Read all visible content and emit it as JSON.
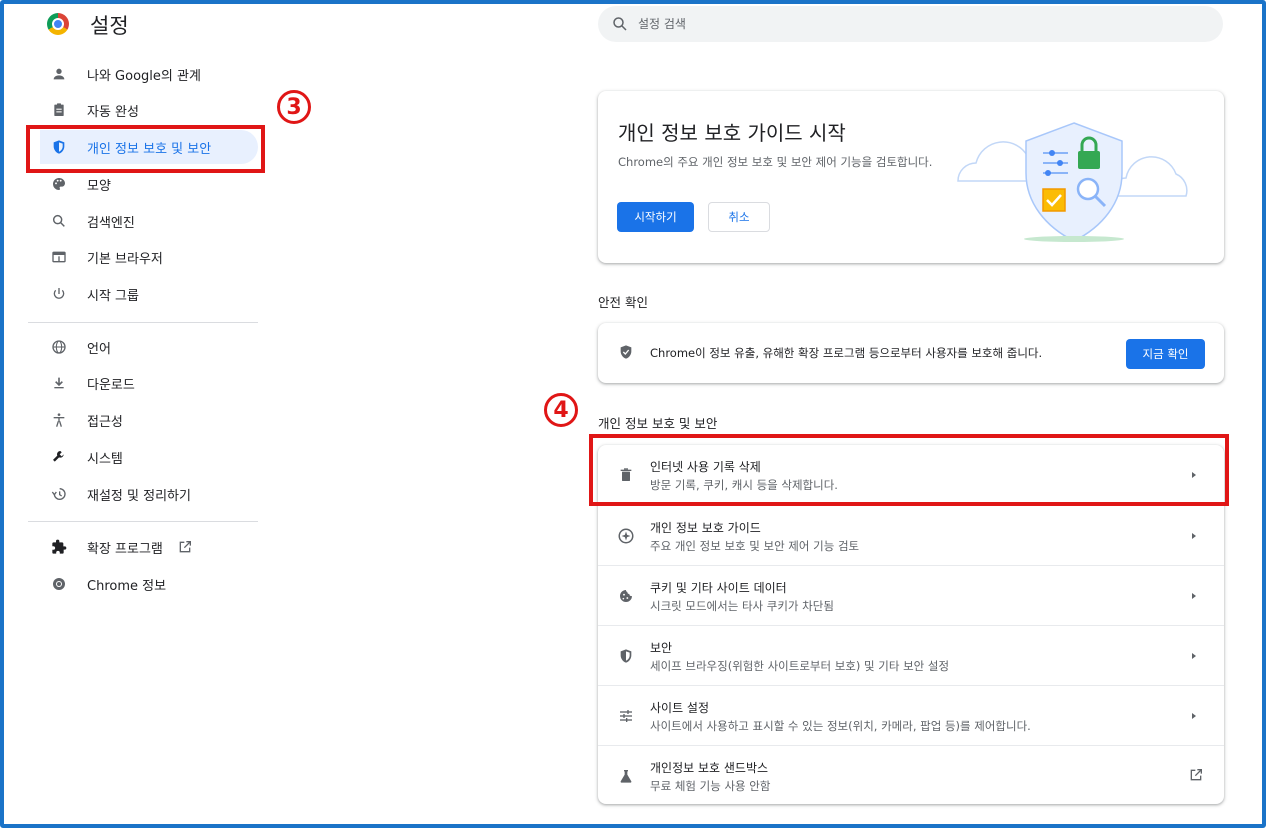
{
  "header": {
    "title": "설정",
    "search_placeholder": "설정 검색"
  },
  "sidebar": {
    "items": [
      {
        "label": "나와 Google의 관계",
        "icon": "person-icon"
      },
      {
        "label": "자동 완성",
        "icon": "clipboard-icon"
      },
      {
        "label": "개인 정보 보호 및 보안",
        "icon": "shield-icon",
        "active": true
      },
      {
        "label": "모양",
        "icon": "palette-icon"
      },
      {
        "label": "검색엔진",
        "icon": "search-icon"
      },
      {
        "label": "기본 브라우저",
        "icon": "browser-icon"
      },
      {
        "label": "시작 그룹",
        "icon": "power-icon"
      },
      {
        "label": "언어",
        "icon": "globe-icon"
      },
      {
        "label": "다운로드",
        "icon": "download-icon"
      },
      {
        "label": "접근성",
        "icon": "accessibility-icon"
      },
      {
        "label": "시스템",
        "icon": "wrench-icon"
      },
      {
        "label": "재설정 및 정리하기",
        "icon": "restore-icon"
      },
      {
        "label": "확장 프로그램",
        "icon": "puzzle-icon"
      },
      {
        "label": "Chrome 정보",
        "icon": "chrome-icon"
      }
    ]
  },
  "annotations": {
    "step3": "3",
    "step4": "4",
    "highlight_color": "#e01616"
  },
  "guide": {
    "title": "개인 정보 보호 가이드 시작",
    "description": "Chrome의 주요 개인 정보 보호 및 보안 제어 기능을 검토합니다.",
    "start_button": "시작하기",
    "cancel_button": "취소"
  },
  "safety_check": {
    "heading": "안전 확인",
    "text": "Chrome이 정보 유출, 유해한 확장 프로그램 등으로부터 사용자를 보호해 줍니다.",
    "button": "지금 확인"
  },
  "privacy": {
    "heading": "개인 정보 보호 및 보안",
    "rows": [
      {
        "title": "인터넷 사용 기록 삭제",
        "subtitle": "방문 기록, 쿠키, 캐시 등을 삭제합니다.",
        "icon": "trash-icon"
      },
      {
        "title": "개인 정보 보호 가이드",
        "subtitle": "주요 개인 정보 보호 및 보안 제어 기능 검토",
        "icon": "compass-icon"
      },
      {
        "title": "쿠키 및 기타 사이트 데이터",
        "subtitle": "시크릿 모드에서는 타사 쿠키가 차단됨",
        "icon": "cookie-icon"
      },
      {
        "title": "보안",
        "subtitle": "세이프 브라우징(위험한 사이트로부터 보호) 및 기타 보안 설정",
        "icon": "shield-icon"
      },
      {
        "title": "사이트 설정",
        "subtitle": "사이트에서 사용하고 표시할 수 있는 정보(위치, 카메라, 팝업 등)를 제어합니다.",
        "icon": "sliders-icon"
      },
      {
        "title": "개인정보 보호 샌드박스",
        "subtitle": "무료 체험 기능 사용 안함",
        "icon": "flask-icon"
      }
    ]
  },
  "colors": {
    "accent": "#1a73e8",
    "frame": "#1a73c8"
  }
}
